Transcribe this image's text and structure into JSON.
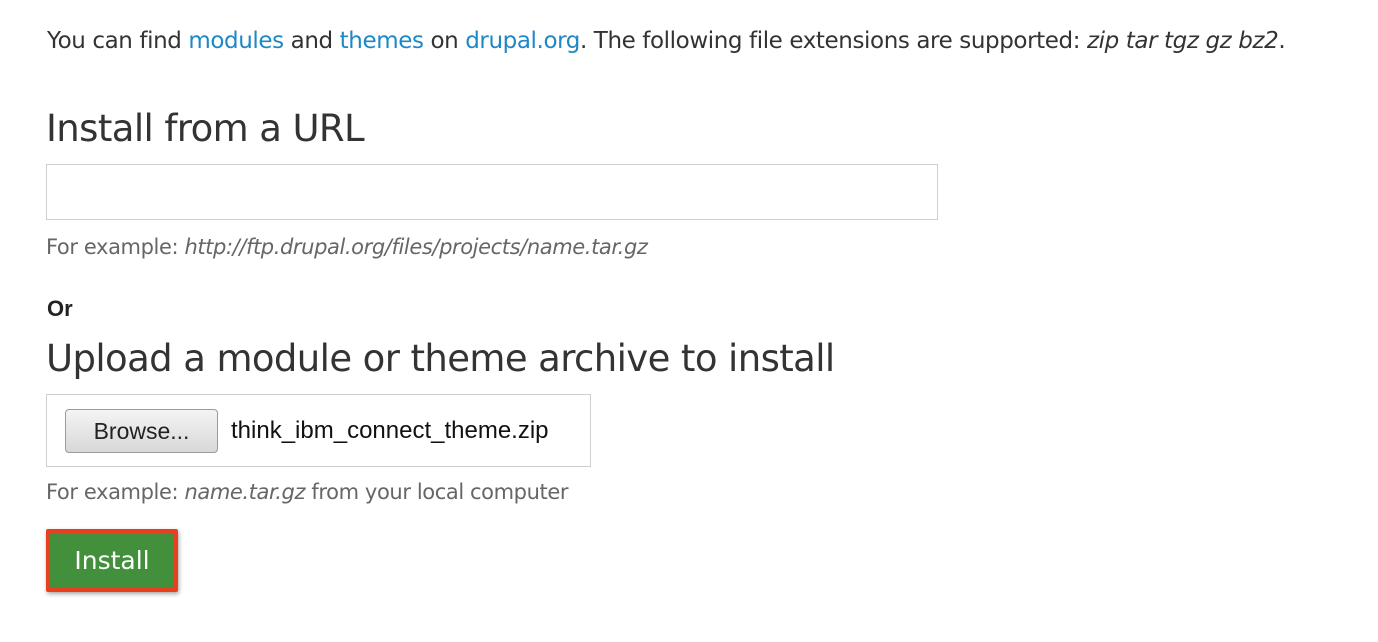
{
  "intro": {
    "prefix": "You can find ",
    "modules_link": "modules",
    "and_text": " and ",
    "themes_link": "themes",
    "on_text": " on ",
    "drupal_link": "drupal.org",
    "supported_text": ". The following file extensions are supported: ",
    "extensions": "zip tar tgz gz bz2",
    "suffix": "."
  },
  "url_section": {
    "heading": "Install from a URL",
    "input_value": "",
    "description_prefix": "For example: ",
    "description_example": "http://ftp.drupal.org/files/projects/name.tar.gz"
  },
  "or_label": "Or",
  "upload_section": {
    "heading": "Upload a module or theme archive to install",
    "browse_label": "Browse...",
    "file_name": "think_ibm_connect_theme.zip",
    "description_prefix": "For example: ",
    "description_example": "name.tar.gz",
    "description_suffix": " from your local computer"
  },
  "install_button": {
    "label": "Install",
    "color": "#42903c",
    "highlight_color": "#e8401f"
  },
  "colors": {
    "link": "#1e88c7",
    "text": "#333333",
    "description": "#666666"
  }
}
